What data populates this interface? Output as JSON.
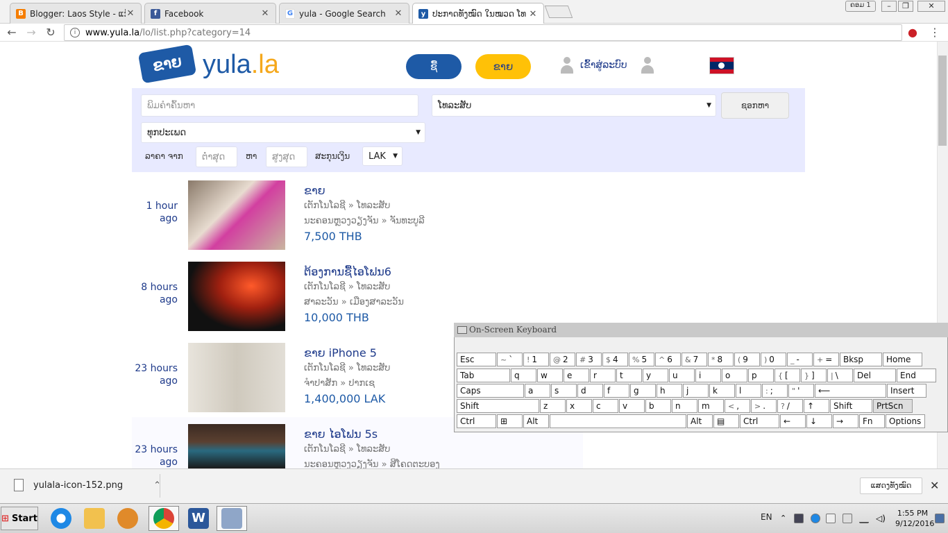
{
  "browser": {
    "tabs": [
      {
        "title": "Blogger: Laos Style - ແກ້ໄຂ",
        "icon": "blogger-icon",
        "active": false
      },
      {
        "title": "Facebook",
        "icon": "facebook-icon",
        "active": false
      },
      {
        "title": "yula - Google Search",
        "icon": "google-icon",
        "active": false
      },
      {
        "title": "ປະກາດທັງໝົດ ໃນໝວດ ໂທ",
        "icon": "yula-icon",
        "active": true
      }
    ],
    "user_label": "ຄອມ 1",
    "url": {
      "domain": "www.yula.la",
      "path": "/lo/list.php?category=14"
    }
  },
  "site": {
    "logo_badge": "ຂາຍ",
    "logo_name": "yula",
    "logo_tld": ".la",
    "buy_label": "ຊື້",
    "sell_label": "ຂາຍ",
    "login_label": "ເຂົ້າສູ່ລະບົບ"
  },
  "search": {
    "keyword_placeholder": "ພິມຄຳຄົ້ນຫາ",
    "category_value": "ໂທລະສັບ",
    "search_button": "ຊອກຫາ",
    "type_value": "ທຸກປະເພດ",
    "price_label": "ລາຄາ ຈາກ",
    "min_placeholder": "ຕ່ຳສຸດ",
    "to_label": "ຫາ",
    "max_placeholder": "ສູງສຸດ",
    "currency_label": "ສະກຸນເງິນ",
    "currency_value": "LAK"
  },
  "listings": [
    {
      "time": "1 hour ago",
      "title": "ຂາຍ",
      "category": "ເຕັກໂນໂລຊີ » ໂທລະສັບ",
      "location": "ນະຄອນຫຼວງວຽງຈັນ » ຈັນທະບູລີ",
      "price": "7,500 THB",
      "thumb_color": "#c9b5a0"
    },
    {
      "time": "8 hours ago",
      "title": "ຕ້ອງການຊື້ໄອໂຟນ6",
      "category": "ເຕັກໂນໂລຊີ » ໂທລະສັບ",
      "location": "ສາລະວັນ » ເມືອງສາລະວັນ",
      "price": "10,000 THB",
      "thumb_color": "#1a1a1a"
    },
    {
      "time": "23 hours ago",
      "title": "ຂາຍ iPhone 5",
      "category": "ເຕັກໂນໂລຊີ » ໂທລະສັບ",
      "location": "ຈຳປາສັກ » ປາກເຊ",
      "price": "1,400,000 LAK",
      "thumb_color": "#d8d4cc"
    },
    {
      "time": "23 hours ago",
      "title": "ຂາຍ ໄອໂຟນ 5s",
      "category": "ເຕັກໂນໂລຊີ » ໂທລະສັບ",
      "location": "ນະຄອນຫຼວງວຽງຈັນ » ສີໂຄດຕະບອງ",
      "price": "",
      "thumb_color": "#3b2a22"
    }
  ],
  "osk": {
    "title": "On-Screen Keyboard",
    "rows": [
      [
        [
          "Esc",
          ""
        ],
        [
          "`",
          "~"
        ],
        [
          "1",
          "!"
        ],
        [
          "2",
          "@"
        ],
        [
          "3",
          "#"
        ],
        [
          "4",
          "$"
        ],
        [
          "5",
          "%"
        ],
        [
          "6",
          "^"
        ],
        [
          "7",
          "&"
        ],
        [
          "8",
          "*"
        ],
        [
          "9",
          "("
        ],
        [
          "0",
          ")"
        ],
        [
          "-",
          "_"
        ],
        [
          "=",
          "+"
        ],
        [
          "Bksp",
          ""
        ],
        [
          "Home",
          ""
        ]
      ],
      [
        [
          "Tab",
          ""
        ],
        [
          "q",
          ""
        ],
        [
          "w",
          ""
        ],
        [
          "e",
          ""
        ],
        [
          "r",
          ""
        ],
        [
          "t",
          ""
        ],
        [
          "y",
          ""
        ],
        [
          "u",
          ""
        ],
        [
          "i",
          ""
        ],
        [
          "o",
          ""
        ],
        [
          "p",
          ""
        ],
        [
          "[",
          "{"
        ],
        [
          "]",
          "}"
        ],
        [
          "\\",
          "|"
        ],
        [
          "Del",
          ""
        ],
        [
          "End",
          ""
        ]
      ],
      [
        [
          "Caps",
          ""
        ],
        [
          "a",
          ""
        ],
        [
          "s",
          ""
        ],
        [
          "d",
          ""
        ],
        [
          "f",
          ""
        ],
        [
          "g",
          ""
        ],
        [
          "h",
          ""
        ],
        [
          "j",
          ""
        ],
        [
          "k",
          ""
        ],
        [
          "l",
          ""
        ],
        [
          ";",
          ":"
        ],
        [
          "'",
          "\""
        ],
        [
          "⟵",
          ""
        ],
        [
          "Insert",
          ""
        ]
      ],
      [
        [
          "Shift",
          ""
        ],
        [
          "z",
          ""
        ],
        [
          "x",
          ""
        ],
        [
          "c",
          ""
        ],
        [
          "v",
          ""
        ],
        [
          "b",
          ""
        ],
        [
          "n",
          ""
        ],
        [
          "m",
          ""
        ],
        [
          ",",
          "<"
        ],
        [
          ".",
          ">"
        ],
        [
          "/",
          "?"
        ],
        [
          "↑",
          ""
        ],
        [
          "Shift",
          ""
        ],
        [
          "PrtScn",
          ""
        ]
      ],
      [
        [
          "Ctrl",
          ""
        ],
        [
          "⊞",
          ""
        ],
        [
          "Alt",
          ""
        ],
        [
          "",
          ""
        ],
        [
          "Alt",
          ""
        ],
        [
          "▤",
          ""
        ],
        [
          "Ctrl",
          ""
        ],
        [
          "←",
          ""
        ],
        [
          "↓",
          ""
        ],
        [
          "→",
          ""
        ],
        [
          "Fn",
          ""
        ],
        [
          "Options",
          ""
        ]
      ]
    ]
  },
  "download": {
    "filename": "yulala-icon-152.png",
    "show_all": "ແສດງທັງໝົດ"
  },
  "taskbar": {
    "start": "Start",
    "lang": "EN",
    "time": "1:55 PM",
    "date": "9/12/2016"
  }
}
